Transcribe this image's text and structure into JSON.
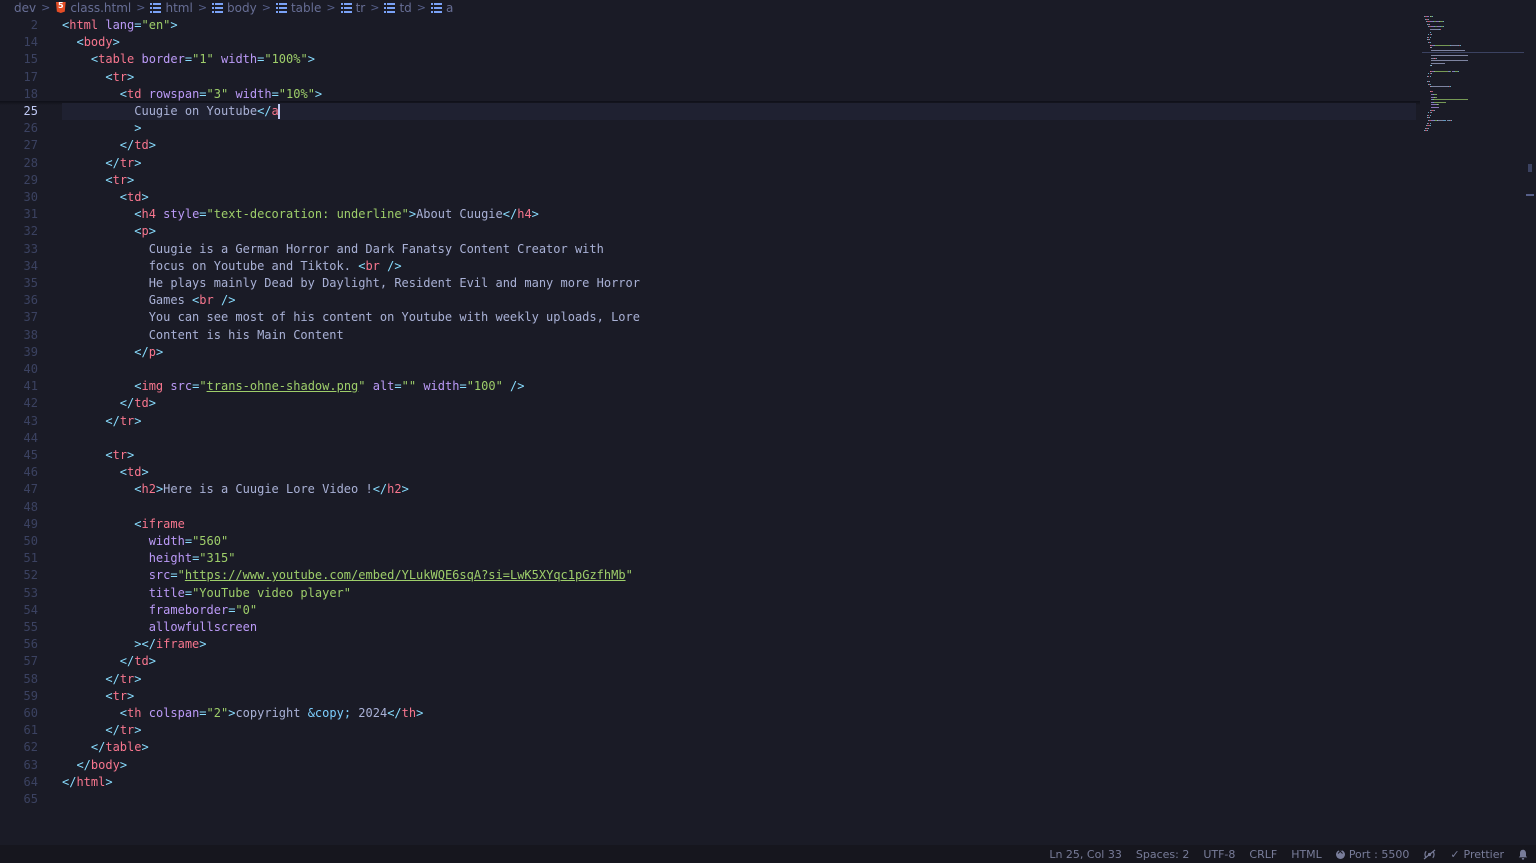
{
  "breadcrumb": {
    "items": [
      {
        "label": "dev",
        "icon": ""
      },
      {
        "label": "class.html",
        "icon": "html5-icon"
      },
      {
        "label": "html",
        "icon": "symbol-icon"
      },
      {
        "label": "body",
        "icon": "symbol-icon"
      },
      {
        "label": "table",
        "icon": "symbol-icon"
      },
      {
        "label": "tr",
        "icon": "symbol-icon"
      },
      {
        "label": "td",
        "icon": "symbol-icon"
      },
      {
        "label": "a",
        "icon": "symbol-icon"
      }
    ]
  },
  "editor": {
    "current_line": "25",
    "lines": [
      {
        "n": "2",
        "tokens": [
          [
            "punc",
            "<"
          ],
          [
            "tag",
            "html "
          ],
          [
            "attr",
            "lang"
          ],
          [
            "punc",
            "="
          ],
          [
            "str",
            "\"en\""
          ],
          [
            "punc",
            ">"
          ]
        ]
      },
      {
        "n": "14",
        "tokens": [
          [
            "txt",
            "  "
          ],
          [
            "punc",
            "<"
          ],
          [
            "tag",
            "body"
          ],
          [
            "punc",
            ">"
          ]
        ]
      },
      {
        "n": "15",
        "tokens": [
          [
            "txt",
            "    "
          ],
          [
            "punc",
            "<"
          ],
          [
            "tag",
            "table "
          ],
          [
            "attr",
            "border"
          ],
          [
            "punc",
            "="
          ],
          [
            "str",
            "\"1\" "
          ],
          [
            "attr",
            "width"
          ],
          [
            "punc",
            "="
          ],
          [
            "str",
            "\"100%\""
          ],
          [
            "punc",
            ">"
          ]
        ]
      },
      {
        "n": "17",
        "tokens": [
          [
            "txt",
            "      "
          ],
          [
            "punc",
            "<"
          ],
          [
            "tag",
            "tr"
          ],
          [
            "punc",
            ">"
          ]
        ]
      },
      {
        "n": "18",
        "tokens": [
          [
            "txt",
            "        "
          ],
          [
            "punc",
            "<"
          ],
          [
            "tag",
            "td "
          ],
          [
            "attr",
            "rowspan"
          ],
          [
            "punc",
            "="
          ],
          [
            "str",
            "\"3\" "
          ],
          [
            "attr",
            "width"
          ],
          [
            "punc",
            "="
          ],
          [
            "str",
            "\"10%\""
          ],
          [
            "punc",
            ">"
          ]
        ]
      },
      {
        "n": "25",
        "tokens": [
          [
            "txt",
            "          Cuugie on Youtube"
          ],
          [
            "punc",
            "</"
          ],
          [
            "tag",
            "a"
          ],
          [
            "cursor",
            ""
          ]
        ]
      },
      {
        "n": "26",
        "tokens": [
          [
            "txt",
            "          "
          ],
          [
            "punc",
            ">"
          ]
        ]
      },
      {
        "n": "27",
        "tokens": [
          [
            "txt",
            "        "
          ],
          [
            "punc",
            "</"
          ],
          [
            "tag",
            "td"
          ],
          [
            "punc",
            ">"
          ]
        ]
      },
      {
        "n": "28",
        "tokens": [
          [
            "txt",
            "      "
          ],
          [
            "punc",
            "</"
          ],
          [
            "tag",
            "tr"
          ],
          [
            "punc",
            ">"
          ]
        ]
      },
      {
        "n": "29",
        "tokens": [
          [
            "txt",
            "      "
          ],
          [
            "punc",
            "<"
          ],
          [
            "tag",
            "tr"
          ],
          [
            "punc",
            ">"
          ]
        ]
      },
      {
        "n": "30",
        "tokens": [
          [
            "txt",
            "        "
          ],
          [
            "punc",
            "<"
          ],
          [
            "tag",
            "td"
          ],
          [
            "punc",
            ">"
          ]
        ]
      },
      {
        "n": "31",
        "tokens": [
          [
            "txt",
            "          "
          ],
          [
            "punc",
            "<"
          ],
          [
            "tag",
            "h4 "
          ],
          [
            "attr",
            "style"
          ],
          [
            "punc",
            "="
          ],
          [
            "str",
            "\"text-decoration: underline\""
          ],
          [
            "punc",
            ">"
          ],
          [
            "txt",
            "About Cuugie"
          ],
          [
            "punc",
            "</"
          ],
          [
            "tag",
            "h4"
          ],
          [
            "punc",
            ">"
          ]
        ]
      },
      {
        "n": "32",
        "tokens": [
          [
            "txt",
            "          "
          ],
          [
            "punc",
            "<"
          ],
          [
            "tag",
            "p"
          ],
          [
            "punc",
            ">"
          ]
        ]
      },
      {
        "n": "33",
        "tokens": [
          [
            "txt",
            "            Cuugie is a German Horror and Dark Fanatsy Content Creator with"
          ]
        ]
      },
      {
        "n": "34",
        "tokens": [
          [
            "txt",
            "            focus on Youtube and Tiktok. "
          ],
          [
            "punc",
            "<"
          ],
          [
            "tag",
            "br "
          ],
          [
            "punc",
            "/>"
          ]
        ]
      },
      {
        "n": "35",
        "tokens": [
          [
            "txt",
            "            He plays mainly Dead by Daylight, Resident Evil and many more Horror"
          ]
        ]
      },
      {
        "n": "36",
        "tokens": [
          [
            "txt",
            "            Games "
          ],
          [
            "punc",
            "<"
          ],
          [
            "tag",
            "br "
          ],
          [
            "punc",
            "/>"
          ]
        ]
      },
      {
        "n": "37",
        "tokens": [
          [
            "txt",
            "            You can see most of his content on Youtube with weekly uploads, Lore"
          ]
        ]
      },
      {
        "n": "38",
        "tokens": [
          [
            "txt",
            "            Content is his Main Content"
          ]
        ]
      },
      {
        "n": "39",
        "tokens": [
          [
            "txt",
            "          "
          ],
          [
            "punc",
            "</"
          ],
          [
            "tag",
            "p"
          ],
          [
            "punc",
            ">"
          ]
        ]
      },
      {
        "n": "40",
        "tokens": []
      },
      {
        "n": "41",
        "tokens": [
          [
            "txt",
            "          "
          ],
          [
            "punc",
            "<"
          ],
          [
            "tag",
            "img "
          ],
          [
            "attr",
            "src"
          ],
          [
            "punc",
            "="
          ],
          [
            "str",
            "\""
          ],
          [
            "link",
            "trans-ohne-shadow.png"
          ],
          [
            "str",
            "\" "
          ],
          [
            "attr",
            "alt"
          ],
          [
            "punc",
            "="
          ],
          [
            "str",
            "\"\" "
          ],
          [
            "attr",
            "width"
          ],
          [
            "punc",
            "="
          ],
          [
            "str",
            "\"100\" "
          ],
          [
            "punc",
            "/>"
          ]
        ]
      },
      {
        "n": "42",
        "tokens": [
          [
            "txt",
            "        "
          ],
          [
            "punc",
            "</"
          ],
          [
            "tag",
            "td"
          ],
          [
            "punc",
            ">"
          ]
        ]
      },
      {
        "n": "43",
        "tokens": [
          [
            "txt",
            "      "
          ],
          [
            "punc",
            "</"
          ],
          [
            "tag",
            "tr"
          ],
          [
            "punc",
            ">"
          ]
        ]
      },
      {
        "n": "44",
        "tokens": []
      },
      {
        "n": "45",
        "tokens": [
          [
            "txt",
            "      "
          ],
          [
            "punc",
            "<"
          ],
          [
            "tag",
            "tr"
          ],
          [
            "punc",
            ">"
          ]
        ]
      },
      {
        "n": "46",
        "tokens": [
          [
            "txt",
            "        "
          ],
          [
            "punc",
            "<"
          ],
          [
            "tag",
            "td"
          ],
          [
            "punc",
            ">"
          ]
        ]
      },
      {
        "n": "47",
        "tokens": [
          [
            "txt",
            "          "
          ],
          [
            "punc",
            "<"
          ],
          [
            "tag",
            "h2"
          ],
          [
            "punc",
            ">"
          ],
          [
            "txt",
            "Here is a Cuugie Lore Video !"
          ],
          [
            "punc",
            "</"
          ],
          [
            "tag",
            "h2"
          ],
          [
            "punc",
            ">"
          ]
        ]
      },
      {
        "n": "48",
        "tokens": []
      },
      {
        "n": "49",
        "tokens": [
          [
            "txt",
            "          "
          ],
          [
            "punc",
            "<"
          ],
          [
            "tag",
            "iframe"
          ]
        ]
      },
      {
        "n": "50",
        "tokens": [
          [
            "txt",
            "            "
          ],
          [
            "attr",
            "width"
          ],
          [
            "punc",
            "="
          ],
          [
            "str",
            "\"560\""
          ]
        ]
      },
      {
        "n": "51",
        "tokens": [
          [
            "txt",
            "            "
          ],
          [
            "attr",
            "height"
          ],
          [
            "punc",
            "="
          ],
          [
            "str",
            "\"315\""
          ]
        ]
      },
      {
        "n": "52",
        "tokens": [
          [
            "txt",
            "            "
          ],
          [
            "attr",
            "src"
          ],
          [
            "punc",
            "="
          ],
          [
            "str",
            "\""
          ],
          [
            "link",
            "https://www.youtube.com/embed/YLukWQE6sqA?si=LwK5XYqc1pGzfhMb"
          ],
          [
            "str",
            "\""
          ]
        ]
      },
      {
        "n": "53",
        "tokens": [
          [
            "txt",
            "            "
          ],
          [
            "attr",
            "title"
          ],
          [
            "punc",
            "="
          ],
          [
            "str",
            "\"YouTube video player\""
          ]
        ]
      },
      {
        "n": "54",
        "tokens": [
          [
            "txt",
            "            "
          ],
          [
            "attr",
            "frameborder"
          ],
          [
            "punc",
            "="
          ],
          [
            "str",
            "\"0\""
          ]
        ]
      },
      {
        "n": "55",
        "tokens": [
          [
            "txt",
            "            "
          ],
          [
            "attr",
            "allowfullscreen"
          ]
        ]
      },
      {
        "n": "56",
        "tokens": [
          [
            "txt",
            "          "
          ],
          [
            "punc",
            "></"
          ],
          [
            "tag",
            "iframe"
          ],
          [
            "punc",
            ">"
          ]
        ]
      },
      {
        "n": "57",
        "tokens": [
          [
            "txt",
            "        "
          ],
          [
            "punc",
            "</"
          ],
          [
            "tag",
            "td"
          ],
          [
            "punc",
            ">"
          ]
        ]
      },
      {
        "n": "58",
        "tokens": [
          [
            "txt",
            "      "
          ],
          [
            "punc",
            "</"
          ],
          [
            "tag",
            "tr"
          ],
          [
            "punc",
            ">"
          ]
        ]
      },
      {
        "n": "59",
        "tokens": [
          [
            "txt",
            "      "
          ],
          [
            "punc",
            "<"
          ],
          [
            "tag",
            "tr"
          ],
          [
            "punc",
            ">"
          ]
        ]
      },
      {
        "n": "60",
        "tokens": [
          [
            "txt",
            "        "
          ],
          [
            "punc",
            "<"
          ],
          [
            "tag",
            "th "
          ],
          [
            "attr",
            "colspan"
          ],
          [
            "punc",
            "="
          ],
          [
            "str",
            "\"2\""
          ],
          [
            "punc",
            ">"
          ],
          [
            "txt",
            "copyright "
          ],
          [
            "ent",
            "&copy;"
          ],
          [
            "txt",
            " 2024"
          ],
          [
            "punc",
            "</"
          ],
          [
            "tag",
            "th"
          ],
          [
            "punc",
            ">"
          ]
        ]
      },
      {
        "n": "61",
        "tokens": [
          [
            "txt",
            "      "
          ],
          [
            "punc",
            "</"
          ],
          [
            "tag",
            "tr"
          ],
          [
            "punc",
            ">"
          ]
        ]
      },
      {
        "n": "62",
        "tokens": [
          [
            "txt",
            "    "
          ],
          [
            "punc",
            "</"
          ],
          [
            "tag",
            "table"
          ],
          [
            "punc",
            ">"
          ]
        ]
      },
      {
        "n": "63",
        "tokens": [
          [
            "txt",
            "  "
          ],
          [
            "punc",
            "</"
          ],
          [
            "tag",
            "body"
          ],
          [
            "punc",
            ">"
          ]
        ]
      },
      {
        "n": "64",
        "tokens": [
          [
            "punc",
            "</"
          ],
          [
            "tag",
            "html"
          ],
          [
            "punc",
            ">"
          ]
        ]
      },
      {
        "n": "65",
        "tokens": []
      }
    ]
  },
  "statusbar": {
    "position": "Ln 25, Col 33",
    "spaces": "Spaces: 2",
    "encoding": "UTF-8",
    "eol": "CRLF",
    "language": "HTML",
    "port": "Port : 5500",
    "formatter": "Prettier"
  },
  "colors": {
    "background": "#1a1b26",
    "tag": "#f7768e",
    "attribute": "#bb9af7",
    "string": "#9ece6a",
    "punctuation": "#89ddff",
    "text": "#a9b1d6",
    "entity": "#7dcfff",
    "statusbar": "#16161e"
  }
}
